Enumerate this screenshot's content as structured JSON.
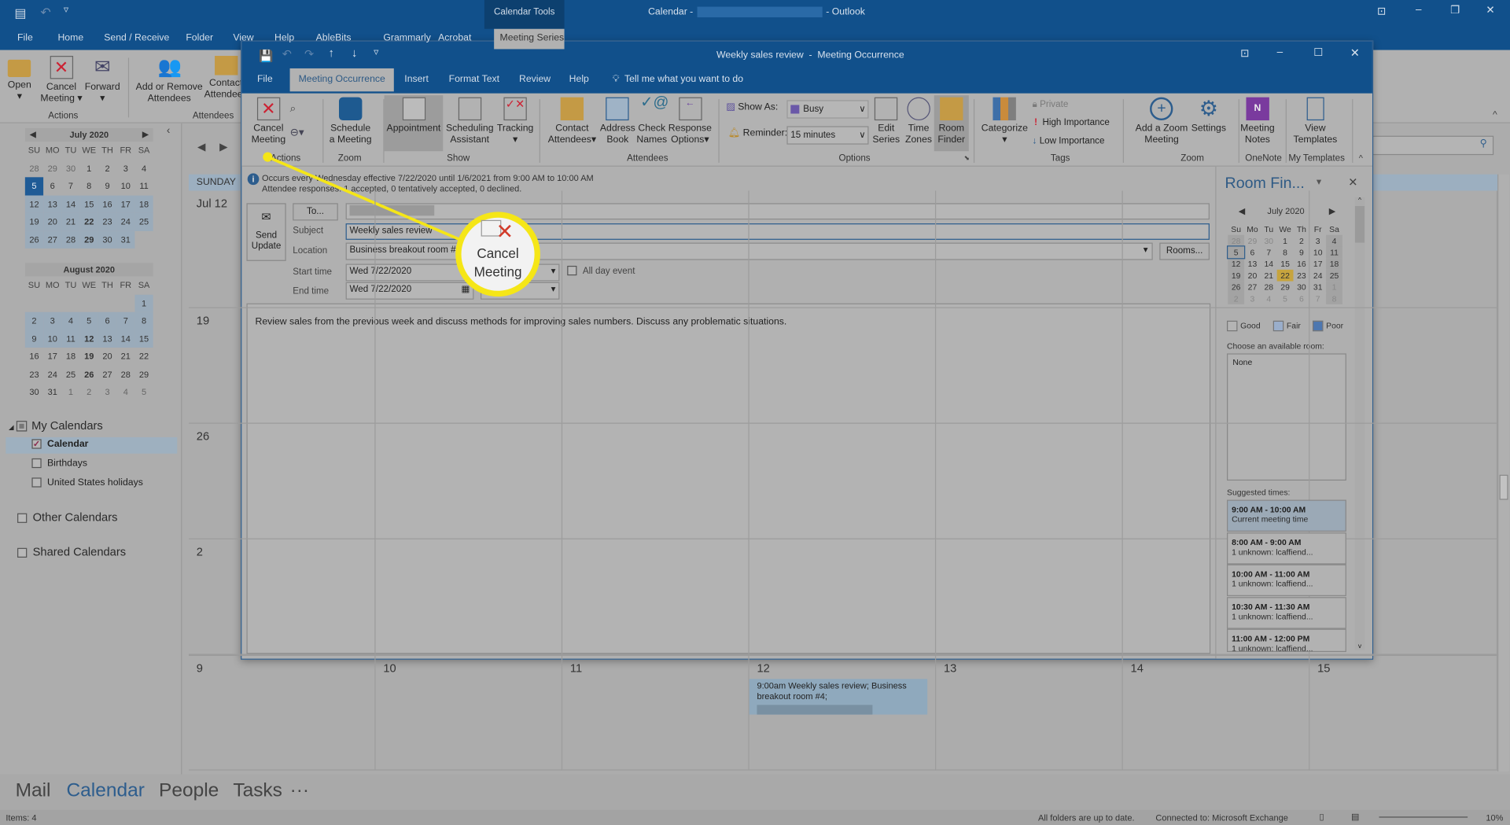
{
  "outlook": {
    "title_prefix": "Calendar -",
    "title_suffix": "- Outlook",
    "contextual_group": "Calendar Tools",
    "tabs": [
      "File",
      "Home",
      "Send / Receive",
      "Folder",
      "View",
      "Help",
      "AbleBits",
      "Grammarly",
      "Acrobat",
      "Meeting Series"
    ],
    "ribbon": {
      "open": "Open",
      "cancel_meeting": [
        "Cancel",
        "Meeting"
      ],
      "forward": "Forward",
      "add_remove": [
        "Add or Remove",
        "Attendees"
      ],
      "contact": [
        "Contact",
        "Attendees"
      ],
      "group_actions": "Actions",
      "group_attendees": "Attendees"
    }
  },
  "mini_calendars": [
    {
      "title": "July 2020",
      "days": [
        "SU",
        "MO",
        "TU",
        "WE",
        "TH",
        "FR",
        "SA"
      ],
      "weeks": [
        [
          "28",
          "29",
          "30",
          "1",
          "2",
          "3",
          "4"
        ],
        [
          "5",
          "6",
          "7",
          "8",
          "9",
          "10",
          "11"
        ],
        [
          "12",
          "13",
          "14",
          "15",
          "16",
          "17",
          "18"
        ],
        [
          "19",
          "20",
          "21",
          "22",
          "23",
          "24",
          "25"
        ],
        [
          "26",
          "27",
          "28",
          "29",
          "30",
          "31",
          ""
        ]
      ]
    },
    {
      "title": "August 2020",
      "days": [
        "SU",
        "MO",
        "TU",
        "WE",
        "TH",
        "FR",
        "SA"
      ],
      "weeks": [
        [
          "",
          "",
          "",
          "",
          "",
          "",
          "1"
        ],
        [
          "2",
          "3",
          "4",
          "5",
          "6",
          "7",
          "8"
        ],
        [
          "9",
          "10",
          "11",
          "12",
          "13",
          "14",
          "15"
        ],
        [
          "16",
          "17",
          "18",
          "19",
          "20",
          "21",
          "22"
        ],
        [
          "23",
          "24",
          "25",
          "26",
          "27",
          "28",
          "29"
        ],
        [
          "30",
          "31",
          "1",
          "2",
          "3",
          "4",
          "5"
        ]
      ]
    }
  ],
  "folders": {
    "my_calendars": "My Calendars",
    "items": [
      {
        "label": "Calendar",
        "checked": true
      },
      {
        "label": "Birthdays",
        "checked": false
      },
      {
        "label": "United States holidays",
        "checked": false
      }
    ],
    "other": "Other Calendars",
    "shared": "Shared Calendars"
  },
  "month_view": {
    "day_header": "SUNDAY",
    "row_starts": [
      "Jul 12",
      "19",
      "26",
      "2"
    ],
    "last_row": [
      "9",
      "10",
      "11",
      "12",
      "13",
      "14",
      "15"
    ],
    "event": "9:00am Weekly sales review; Business breakout room #4;"
  },
  "bottom_nav": [
    "Mail",
    "Calendar",
    "People",
    "Tasks",
    "···"
  ],
  "status": {
    "items": "Items: 4",
    "sync": "All folders are up to date.",
    "connection": "Connected to: Microsoft Exchange",
    "zoom": "10%"
  },
  "meeting": {
    "title": "Weekly sales review  -  Meeting Occurrence",
    "tabs": [
      "File",
      "Meeting Occurrence",
      "Insert",
      "Format Text",
      "Review",
      "Help"
    ],
    "tell_me": "Tell me what you want to do",
    "ribbon": {
      "cancel": [
        "Cancel",
        "Meeting"
      ],
      "schedule": [
        "Schedule",
        "a Meeting"
      ],
      "appointment": "Appointment",
      "scheduling": [
        "Scheduling",
        "Assistant"
      ],
      "tracking": "Tracking",
      "contact": [
        "Contact",
        "Attendees"
      ],
      "address": [
        "Address",
        "Book"
      ],
      "check": [
        "Check",
        "Names"
      ],
      "response": [
        "Response",
        "Options"
      ],
      "show_as_label": "Show As:",
      "show_as": "Busy",
      "reminder_label": "Reminder:",
      "reminder": "15 minutes",
      "edit": [
        "Edit",
        "Series"
      ],
      "zones": [
        "Time",
        "Zones"
      ],
      "room": [
        "Room",
        "Finder"
      ],
      "categorize": "Categorize",
      "private": "Private",
      "high": "High Importance",
      "low": "Low Importance",
      "zoom_add": [
        "Add a Zoom",
        "Meeting"
      ],
      "settings": "Settings",
      "notes": [
        "Meeting",
        "Notes"
      ],
      "templates": [
        "View",
        "Templates"
      ],
      "groups": [
        "Actions",
        "Zoom",
        "Show",
        "Attendees",
        "Options",
        "Tags",
        "Zoom",
        "OneNote",
        "My Templates"
      ]
    },
    "info_line1": "Occurs every Wednesday effective 7/22/2020 until 1/6/2021 from 9:00 AM to 10:00 AM",
    "info_line2": "Attendee responses: 1 accepted, 0 tentatively accepted, 0 declined.",
    "send_update": [
      "Send",
      "Update"
    ],
    "to_button": "To...",
    "subject_label": "Subject",
    "subject": "Weekly sales review",
    "location_label": "Location",
    "location": "Business breakout room #4",
    "rooms_button": "Rooms...",
    "start_label": "Start time",
    "start_date": "Wed 7/22/2020",
    "end_label": "End time",
    "end_date": "Wed 7/22/2020",
    "all_day": "All day event",
    "body": "Review sales from the previous week and discuss methods for improving sales numbers. Discuss any problematic situations."
  },
  "room_finder": {
    "title": "Room Fin...",
    "month": "July 2020",
    "days": [
      "Su",
      "Mo",
      "Tu",
      "We",
      "Th",
      "Fr",
      "Sa"
    ],
    "weeks": [
      [
        "28",
        "29",
        "30",
        "1",
        "2",
        "3",
        "4"
      ],
      [
        "5",
        "6",
        "7",
        "8",
        "9",
        "10",
        "11"
      ],
      [
        "12",
        "13",
        "14",
        "15",
        "16",
        "17",
        "18"
      ],
      [
        "19",
        "20",
        "21",
        "22",
        "23",
        "24",
        "25"
      ],
      [
        "26",
        "27",
        "28",
        "29",
        "30",
        "31",
        "1"
      ],
      [
        "2",
        "3",
        "4",
        "5",
        "6",
        "7",
        "8"
      ]
    ],
    "legend": [
      "Good",
      "Fair",
      "Poor"
    ],
    "choose_label": "Choose an available room:",
    "rooms": [
      "None"
    ],
    "suggested_label": "Suggested times:",
    "suggestions": [
      {
        "time": "9:00 AM - 10:00 AM",
        "note": "Current meeting time"
      },
      {
        "time": "8:00 AM - 9:00 AM",
        "note": "1 unknown: lcaffiend..."
      },
      {
        "time": "10:00 AM - 11:00 AM",
        "note": "1 unknown: lcaffiend..."
      },
      {
        "time": "10:30 AM - 11:30 AM",
        "note": "1 unknown: lcaffiend..."
      },
      {
        "time": "11:00 AM - 12:00 PM",
        "note": "1 unknown: lcaffiend..."
      }
    ]
  },
  "callout": {
    "label": [
      "Cancel",
      "Meeting"
    ],
    "color": "#f5e617"
  },
  "colors": {
    "title_blue": "#11508b",
    "highlight": "#f5e617"
  }
}
